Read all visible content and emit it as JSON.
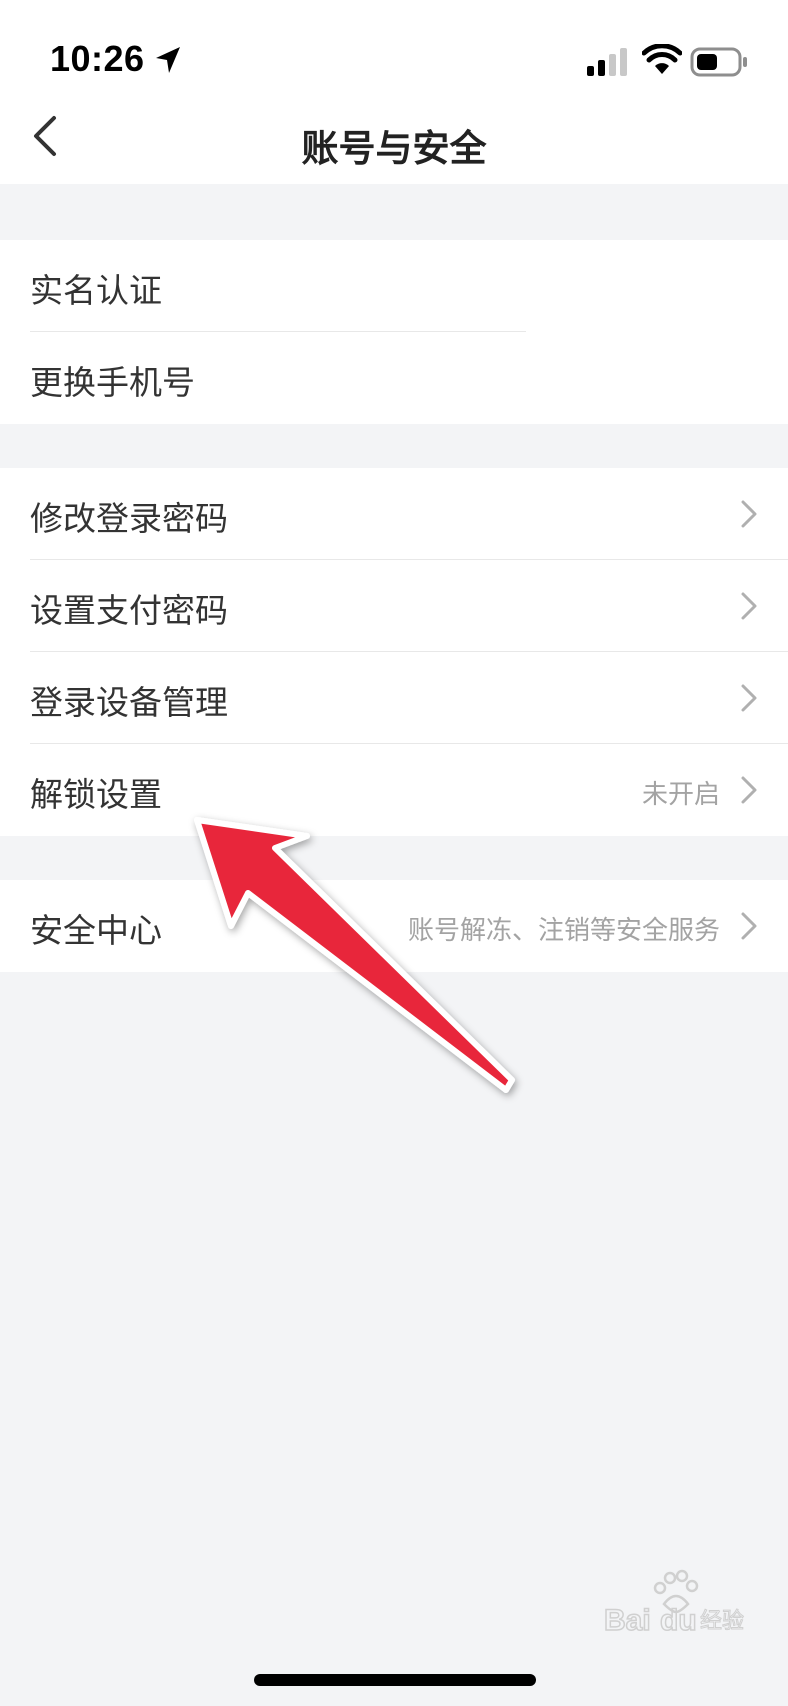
{
  "status_bar": {
    "time": "10:26"
  },
  "nav": {
    "title": "账号与安全",
    "back_icon": "chevron-left-icon"
  },
  "groups": [
    {
      "items": [
        {
          "label": "实名认证",
          "value": "",
          "has_chevron": false
        },
        {
          "label": "更换手机号",
          "value": "",
          "has_chevron": false
        }
      ]
    },
    {
      "items": [
        {
          "label": "修改登录密码",
          "value": "",
          "has_chevron": true
        },
        {
          "label": "设置支付密码",
          "value": "",
          "has_chevron": true
        },
        {
          "label": "登录设备管理",
          "value": "",
          "has_chevron": true
        },
        {
          "label": "解锁设置",
          "value": "未开启",
          "has_chevron": true
        }
      ]
    },
    {
      "items": [
        {
          "label": "安全中心",
          "value": "账号解冻、注销等安全服务",
          "has_chevron": true
        }
      ]
    }
  ],
  "colors": {
    "background": "#f3f4f6",
    "surface": "#ffffff",
    "text_primary": "#333333",
    "text_secondary": "#a3a3a3",
    "annotation_arrow": "#e8283a"
  },
  "watermark": {
    "text": "Baidu经验"
  }
}
